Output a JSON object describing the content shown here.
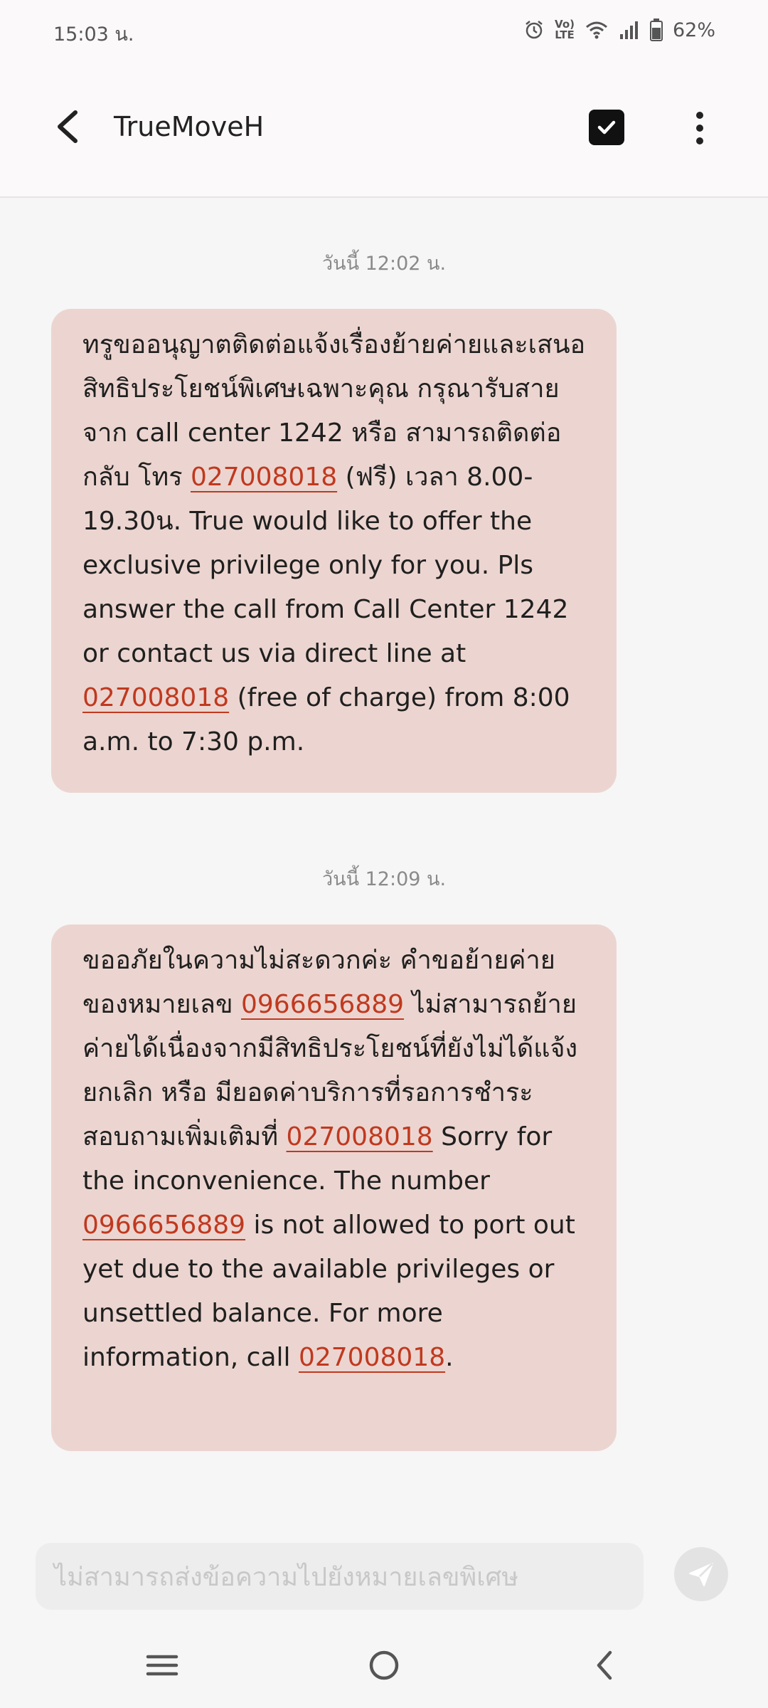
{
  "status_bar": {
    "time": "15:03 น.",
    "volte_line1": "Vo)",
    "volte_line2": "LTE",
    "battery": "62%",
    "icons": [
      "alarm-icon",
      "volte-icon",
      "wifi-icon",
      "signal-icon",
      "battery-icon"
    ]
  },
  "header": {
    "contact_name": "TrueMoveH",
    "icons": [
      "back-arrow-icon",
      "checkbox-icon",
      "more-vert-icon"
    ]
  },
  "messages": [
    {
      "timestamp": "วันนี้ 12:02 น.",
      "segments": [
        {
          "text": "ทรูขออนุญาตติดต่อแจ้งเรื่องย้ายค่ายและเสนอสิทธิประโยชน์พิเศษเฉพาะคุณ กรุณารับสายจาก call center 1242 หรือ สามารถติดต่อกลับ  โทร ",
          "link": false
        },
        {
          "text": "027008018",
          "link": true
        },
        {
          "text": " (ฟรี)  เวลา 8.00-19.30น. True would like to offer the exclusive privilege only for you. Pls answer the call from Call Center 1242 or contact us via direct line at ",
          "link": false
        },
        {
          "text": "027008018",
          "link": true
        },
        {
          "text": " (free of charge) from 8:00 a.m. to 7:30 p.m.",
          "link": false
        }
      ]
    },
    {
      "timestamp": "วันนี้ 12:09 น.",
      "segments": [
        {
          "text": "ขออภัยในความไม่สะดวกค่ะ คำขอย้ายค่ายของหมายเลข ",
          "link": false
        },
        {
          "text": "0966656889",
          "link": true
        },
        {
          "text": " ไม่สามารถย้ายค่ายได้เนื่องจากมีสิทธิประโยชน์ที่ยังไม่ได้แจ้งยกเลิก หรือ มียอดค่าบริการที่รอการชำระ สอบถามเพิ่มเติมที่ ",
          "link": false
        },
        {
          "text": "027008018",
          "link": true
        },
        {
          "text": " Sorry for the inconvenience. The number ",
          "link": false
        },
        {
          "text": "0966656889",
          "link": true
        },
        {
          "text": " is not allowed to port out yet due to the available privileges or unsettled balance. For more information, call ",
          "link": false
        },
        {
          "text": "027008018",
          "link": true
        },
        {
          "text": ".",
          "link": false
        }
      ]
    }
  ],
  "composer": {
    "placeholder": "ไม่สามารถส่งข้อความไปยังหมายเลขพิเศษ",
    "icons": [
      "send-icon"
    ]
  },
  "nav_bar": {
    "icons": [
      "recent-apps-icon",
      "home-icon",
      "back-icon"
    ]
  },
  "colors": {
    "bubble": "#ecd5d0",
    "link": "#c0391f",
    "background": "#f6f6f6",
    "header": "#fcf9fb"
  }
}
